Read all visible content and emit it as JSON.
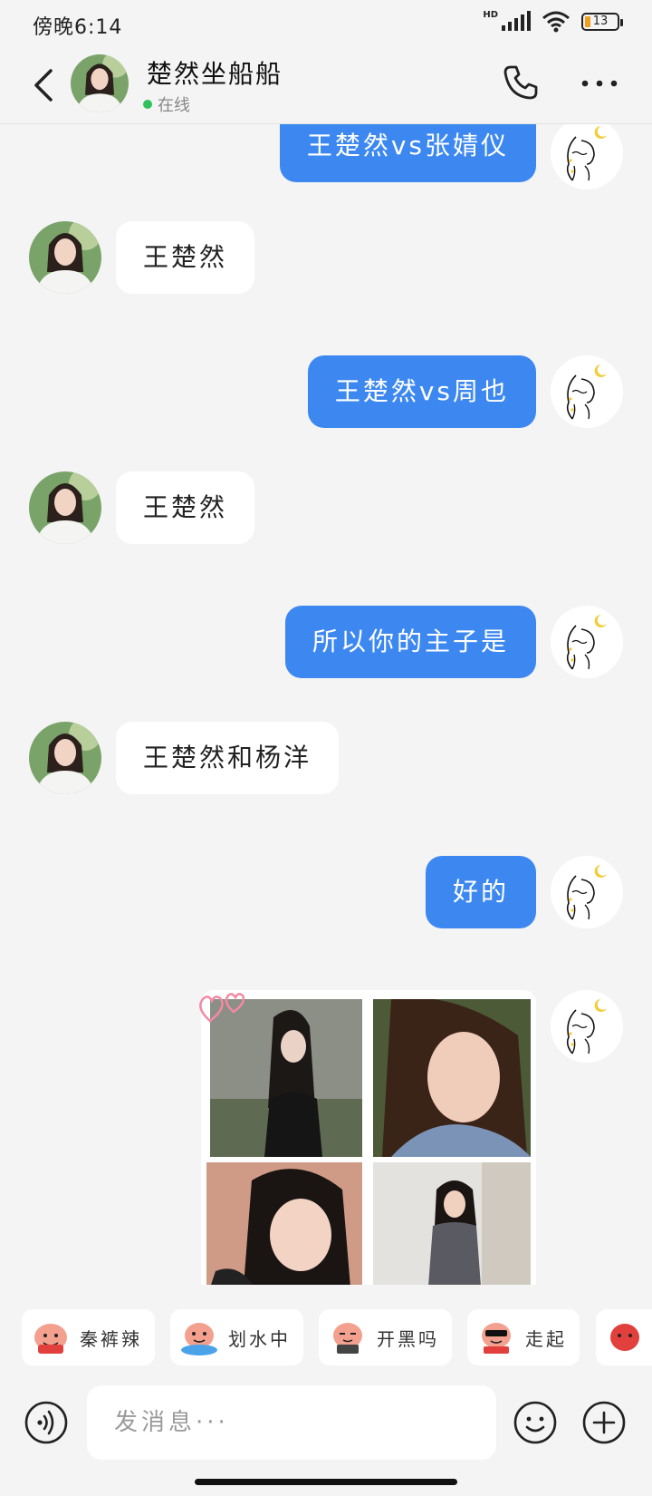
{
  "status_bar": {
    "time": "傍晚6:14",
    "network": "HD",
    "battery": "13"
  },
  "header": {
    "contact_name": "楚然坐船船",
    "status": "在线"
  },
  "messages": [
    {
      "side": "me",
      "text": "王楚然vs张婧仪"
    },
    {
      "side": "other",
      "text": "王楚然"
    },
    {
      "side": "me",
      "text": "王楚然vs周也"
    },
    {
      "side": "other",
      "text": "王楚然"
    },
    {
      "side": "me",
      "text": "所以你的主子是"
    },
    {
      "side": "other",
      "text": "王楚然和杨洋"
    },
    {
      "side": "me",
      "text": "好的"
    }
  ],
  "image_message": {
    "photo_count": 4
  },
  "quick_stickers": [
    {
      "label": "秦裤辣",
      "icon": "sticker-face-icon"
    },
    {
      "label": "划水中",
      "icon": "sticker-face-icon"
    },
    {
      "label": "开黑吗",
      "icon": "sticker-face-icon"
    },
    {
      "label": "走起",
      "icon": "sticker-face-icon"
    }
  ],
  "composer": {
    "placeholder": "发消息···"
  },
  "colors": {
    "outgoing_bubble": "#3d88f0",
    "incoming_bubble": "#ffffff",
    "online_dot": "#2fc25b",
    "background": "#f4f4f4"
  }
}
